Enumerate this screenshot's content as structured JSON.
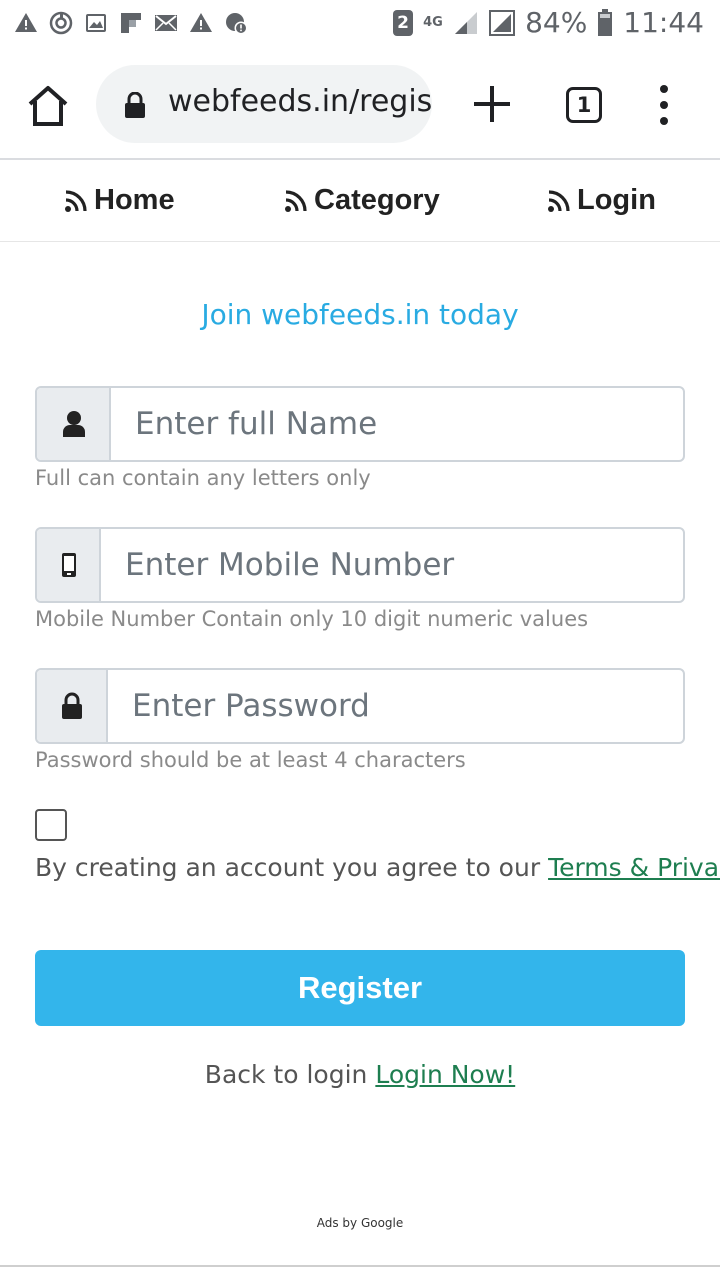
{
  "status_bar": {
    "left_icons": [
      "warning-icon",
      "sync-icon",
      "image-icon",
      "flipboard-icon",
      "mail-icon",
      "warning-icon",
      "settings-alert-icon"
    ],
    "sim_badge": "2",
    "network": "4G",
    "battery": "84%",
    "time": "11:44"
  },
  "browser": {
    "url": "webfeeds.in/register",
    "tab_count": "1"
  },
  "nav": {
    "home": "Home",
    "category": "Category",
    "login": "Login"
  },
  "form": {
    "title": "Join webfeeds.in today",
    "name_placeholder": "Enter full Name",
    "name_help": "Full can contain any letters only",
    "mobile_placeholder": "Enter Mobile Number",
    "mobile_help": "Mobile Number Contain only 10 digit numeric values",
    "password_placeholder": "Enter Password",
    "password_help": "Password should be at least 4 characters",
    "agree_text": "By creating an account you agree to our ",
    "terms_link": "Terms & Privacy",
    "register_button": "Register",
    "back_text": "Back to login ",
    "login_now_link": "Login Now!"
  },
  "footer": {
    "ads": "Ads by Google"
  },
  "colors": {
    "accent": "#29abe2",
    "button": "#33b5eb",
    "link": "#1e7e50"
  }
}
